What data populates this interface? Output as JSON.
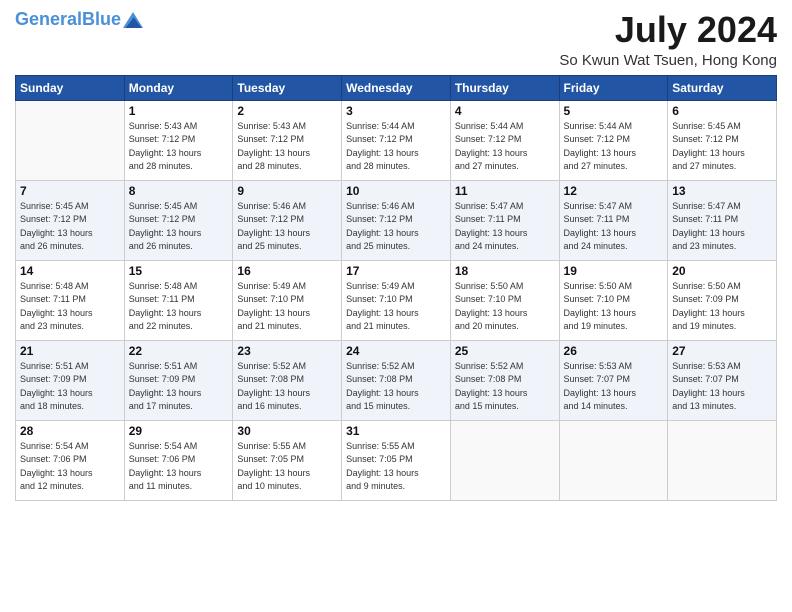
{
  "header": {
    "logo_line1": "General",
    "logo_line2": "Blue",
    "month": "July 2024",
    "location": "So Kwun Wat Tsuen, Hong Kong"
  },
  "weekdays": [
    "Sunday",
    "Monday",
    "Tuesday",
    "Wednesday",
    "Thursday",
    "Friday",
    "Saturday"
  ],
  "weeks": [
    [
      {
        "day": "",
        "info": ""
      },
      {
        "day": "1",
        "info": "Sunrise: 5:43 AM\nSunset: 7:12 PM\nDaylight: 13 hours\nand 28 minutes."
      },
      {
        "day": "2",
        "info": "Sunrise: 5:43 AM\nSunset: 7:12 PM\nDaylight: 13 hours\nand 28 minutes."
      },
      {
        "day": "3",
        "info": "Sunrise: 5:44 AM\nSunset: 7:12 PM\nDaylight: 13 hours\nand 28 minutes."
      },
      {
        "day": "4",
        "info": "Sunrise: 5:44 AM\nSunset: 7:12 PM\nDaylight: 13 hours\nand 27 minutes."
      },
      {
        "day": "5",
        "info": "Sunrise: 5:44 AM\nSunset: 7:12 PM\nDaylight: 13 hours\nand 27 minutes."
      },
      {
        "day": "6",
        "info": "Sunrise: 5:45 AM\nSunset: 7:12 PM\nDaylight: 13 hours\nand 27 minutes."
      }
    ],
    [
      {
        "day": "7",
        "info": "Sunrise: 5:45 AM\nSunset: 7:12 PM\nDaylight: 13 hours\nand 26 minutes."
      },
      {
        "day": "8",
        "info": "Sunrise: 5:45 AM\nSunset: 7:12 PM\nDaylight: 13 hours\nand 26 minutes."
      },
      {
        "day": "9",
        "info": "Sunrise: 5:46 AM\nSunset: 7:12 PM\nDaylight: 13 hours\nand 25 minutes."
      },
      {
        "day": "10",
        "info": "Sunrise: 5:46 AM\nSunset: 7:12 PM\nDaylight: 13 hours\nand 25 minutes."
      },
      {
        "day": "11",
        "info": "Sunrise: 5:47 AM\nSunset: 7:11 PM\nDaylight: 13 hours\nand 24 minutes."
      },
      {
        "day": "12",
        "info": "Sunrise: 5:47 AM\nSunset: 7:11 PM\nDaylight: 13 hours\nand 24 minutes."
      },
      {
        "day": "13",
        "info": "Sunrise: 5:47 AM\nSunset: 7:11 PM\nDaylight: 13 hours\nand 23 minutes."
      }
    ],
    [
      {
        "day": "14",
        "info": "Sunrise: 5:48 AM\nSunset: 7:11 PM\nDaylight: 13 hours\nand 23 minutes."
      },
      {
        "day": "15",
        "info": "Sunrise: 5:48 AM\nSunset: 7:11 PM\nDaylight: 13 hours\nand 22 minutes."
      },
      {
        "day": "16",
        "info": "Sunrise: 5:49 AM\nSunset: 7:10 PM\nDaylight: 13 hours\nand 21 minutes."
      },
      {
        "day": "17",
        "info": "Sunrise: 5:49 AM\nSunset: 7:10 PM\nDaylight: 13 hours\nand 21 minutes."
      },
      {
        "day": "18",
        "info": "Sunrise: 5:50 AM\nSunset: 7:10 PM\nDaylight: 13 hours\nand 20 minutes."
      },
      {
        "day": "19",
        "info": "Sunrise: 5:50 AM\nSunset: 7:10 PM\nDaylight: 13 hours\nand 19 minutes."
      },
      {
        "day": "20",
        "info": "Sunrise: 5:50 AM\nSunset: 7:09 PM\nDaylight: 13 hours\nand 19 minutes."
      }
    ],
    [
      {
        "day": "21",
        "info": "Sunrise: 5:51 AM\nSunset: 7:09 PM\nDaylight: 13 hours\nand 18 minutes."
      },
      {
        "day": "22",
        "info": "Sunrise: 5:51 AM\nSunset: 7:09 PM\nDaylight: 13 hours\nand 17 minutes."
      },
      {
        "day": "23",
        "info": "Sunrise: 5:52 AM\nSunset: 7:08 PM\nDaylight: 13 hours\nand 16 minutes."
      },
      {
        "day": "24",
        "info": "Sunrise: 5:52 AM\nSunset: 7:08 PM\nDaylight: 13 hours\nand 15 minutes."
      },
      {
        "day": "25",
        "info": "Sunrise: 5:52 AM\nSunset: 7:08 PM\nDaylight: 13 hours\nand 15 minutes."
      },
      {
        "day": "26",
        "info": "Sunrise: 5:53 AM\nSunset: 7:07 PM\nDaylight: 13 hours\nand 14 minutes."
      },
      {
        "day": "27",
        "info": "Sunrise: 5:53 AM\nSunset: 7:07 PM\nDaylight: 13 hours\nand 13 minutes."
      }
    ],
    [
      {
        "day": "28",
        "info": "Sunrise: 5:54 AM\nSunset: 7:06 PM\nDaylight: 13 hours\nand 12 minutes."
      },
      {
        "day": "29",
        "info": "Sunrise: 5:54 AM\nSunset: 7:06 PM\nDaylight: 13 hours\nand 11 minutes."
      },
      {
        "day": "30",
        "info": "Sunrise: 5:55 AM\nSunset: 7:05 PM\nDaylight: 13 hours\nand 10 minutes."
      },
      {
        "day": "31",
        "info": "Sunrise: 5:55 AM\nSunset: 7:05 PM\nDaylight: 13 hours\nand 9 minutes."
      },
      {
        "day": "",
        "info": ""
      },
      {
        "day": "",
        "info": ""
      },
      {
        "day": "",
        "info": ""
      }
    ]
  ]
}
